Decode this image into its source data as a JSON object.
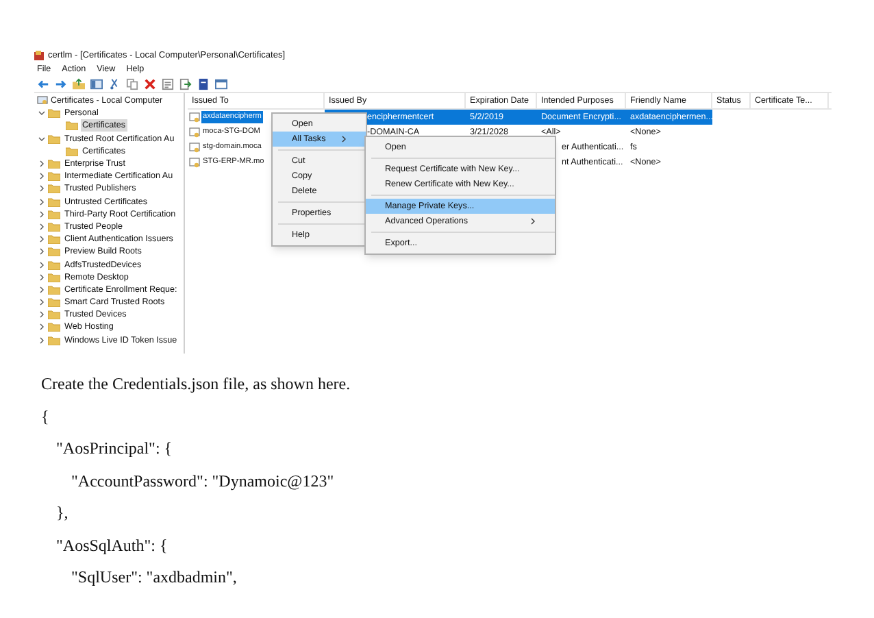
{
  "window": {
    "title": "certlm - [Certificates - Local Computer\\Personal\\Certificates]"
  },
  "menu_bar": [
    "File",
    "Action",
    "View",
    "Help"
  ],
  "tree": {
    "root": "Certificates - Local Computer",
    "items": [
      {
        "label": "Personal",
        "expanded": true,
        "selected": false,
        "children": [
          {
            "label": "Certificates",
            "selected": true
          }
        ]
      },
      {
        "label": "Trusted Root Certification Au",
        "expanded": true,
        "selected": false,
        "children": [
          {
            "label": "Certificates",
            "selected": false
          }
        ]
      },
      {
        "label": "Enterprise Trust",
        "expanded": false,
        "selected": false
      },
      {
        "label": "Intermediate Certification Au",
        "expanded": false,
        "selected": false
      },
      {
        "label": "Trusted Publishers",
        "expanded": false,
        "selected": false
      },
      {
        "label": "Untrusted Certificates",
        "expanded": false,
        "selected": false
      },
      {
        "label": "Third-Party Root Certification",
        "expanded": false,
        "selected": false
      },
      {
        "label": "Trusted People",
        "expanded": false,
        "selected": false
      },
      {
        "label": "Client Authentication Issuers",
        "expanded": false,
        "selected": false
      },
      {
        "label": "Preview Build Roots",
        "expanded": false,
        "selected": false
      },
      {
        "label": "AdfsTrustedDevices",
        "expanded": false,
        "selected": false
      },
      {
        "label": "Remote Desktop",
        "expanded": false,
        "selected": false
      },
      {
        "label": "Certificate Enrollment Reque:",
        "expanded": false,
        "selected": false
      },
      {
        "label": "Smart Card Trusted Roots",
        "expanded": false,
        "selected": false
      },
      {
        "label": "Trusted Devices",
        "expanded": false,
        "selected": false
      },
      {
        "label": "Web Hosting",
        "expanded": false,
        "selected": false
      },
      {
        "label": "Windows Live ID Token Issue",
        "expanded": false,
        "selected": false
      }
    ]
  },
  "table": {
    "columns": [
      "Issued To",
      "Issued By",
      "Expiration Date",
      "Intended Purposes",
      "Friendly Name",
      "Status",
      "Certificate Te..."
    ],
    "rows": [
      {
        "selected": true,
        "issued_to": "axdataencipherm",
        "issued_by": "enciphermentcert",
        "expiration_date": "5/2/2019",
        "intended_purposes": "Document Encrypti...",
        "friendly_name": "axdataenciphermen..."
      },
      {
        "selected": false,
        "issued_to": "moca-STG-DOM",
        "issued_by": "-DOMAIN-CA",
        "expiration_date": "3/21/2028",
        "intended_purposes": "<All>",
        "friendly_name": "<None>"
      },
      {
        "selected": false,
        "issued_to": "stg-domain.moca",
        "intended_purposes": "er Authenticati...",
        "friendly_name": "fs"
      },
      {
        "selected": false,
        "issued_to": "STG-ERP-MR.mo",
        "intended_purposes": "nt Authenticati...",
        "friendly_name": "<None>"
      }
    ]
  },
  "context_menu": [
    {
      "kind": "item",
      "label": "Open",
      "selected": false
    },
    {
      "kind": "item",
      "label": "All Tasks",
      "selected": true,
      "submenu": true
    },
    {
      "kind": "separator"
    },
    {
      "kind": "item",
      "label": "Cut",
      "selected": false
    },
    {
      "kind": "item",
      "label": "Copy",
      "selected": false
    },
    {
      "kind": "item",
      "label": "Delete",
      "selected": false
    },
    {
      "kind": "separator"
    },
    {
      "kind": "item",
      "label": "Properties",
      "selected": false
    },
    {
      "kind": "separator"
    },
    {
      "kind": "item",
      "label": "Help",
      "selected": false
    }
  ],
  "submenu": [
    {
      "kind": "item",
      "label": "Open",
      "selected": false
    },
    {
      "kind": "separator"
    },
    {
      "kind": "item",
      "label": "Request Certificate with New Key...",
      "selected": false
    },
    {
      "kind": "item",
      "label": "Renew Certificate with New Key...",
      "selected": false
    },
    {
      "kind": "separator"
    },
    {
      "kind": "item",
      "label": "Manage Private Keys...",
      "selected": true
    },
    {
      "kind": "item",
      "label": "Advanced Operations",
      "selected": false,
      "submenu": true
    },
    {
      "kind": "separator"
    },
    {
      "kind": "item",
      "label": "Export...",
      "selected": false
    }
  ],
  "document": {
    "paragraph": "Create the Credentials.json file, as shown here.",
    "code_lines": [
      {
        "text": "{",
        "children": [
          {
            "text": "\"AosPrincipal\": {",
            "children": [
              {
                "text": "\"AccountPassword\": \"Dynamoic@123\""
              }
            ]
          },
          {
            "text": "},"
          },
          {
            "text": "\"AosSqlAuth\": {",
            "children": [
              {
                "text": "\"SqlUser\": \"axdbadmin\","
              }
            ]
          }
        ]
      }
    ]
  }
}
